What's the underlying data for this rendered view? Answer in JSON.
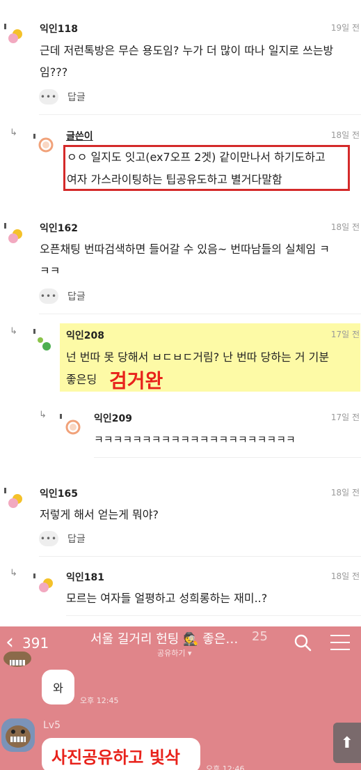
{
  "comments": [
    {
      "nick": "익인118",
      "time": "19일 전",
      "lines": [
        "근데 저런톡방은 무슨 용도임? 누가 더 많이 따나 일지로 쓰는방",
        "임???"
      ],
      "reply_label": "답글"
    },
    {
      "nick": "글쓴이",
      "time": "18일 전",
      "lines": [
        "ㅇㅇ 일지도 잇고(ex7오프 2겟) 같이만나서 하기도하고",
        "여자 가스라이팅하는 팁공유도하고 별거다말함"
      ]
    },
    {
      "nick": "익인162",
      "time": "18일 전",
      "lines": [
        "오픈채팅 번따검색하면 들어갈 수 있음~ 번따남들의 실체임 ㅋ",
        "ㅋㅋ"
      ],
      "reply_label": "답글"
    },
    {
      "nick": "익인208",
      "time": "17일 전",
      "lines": [
        "넌 번따 못 당해서 ㅂㄷㅂㄷ거림? 난 번따 당하는 거 기분",
        "좋은딩"
      ],
      "annotation": "검거완"
    },
    {
      "nick": "익인209",
      "time": "17일 전",
      "lines": [
        "ㅋㅋㅋㅋㅋㅋㅋㅋㅋㅋㅋㅋㅋㅋㅋㅋㅋㅋㅋㅋㅋ"
      ]
    },
    {
      "nick": "익인165",
      "time": "18일 전",
      "lines": [
        "저렇게 해서 얻는게 뭐야?"
      ],
      "reply_label": "답글"
    },
    {
      "nick": "익인181",
      "time": "18일 전",
      "lines": [
        "모르는 여자들 얼평하고 성희롱하는 재미..?"
      ]
    }
  ],
  "chat": {
    "back_count": "391",
    "title": "서울 길거리 헌팅 🕵️ 좋은…",
    "members": "25",
    "subtitle": "공유하기 ▾",
    "msg1": "와",
    "msg1_time": "오후 12:45",
    "level": "Lv5",
    "annotation": "사진공유하고 빛삭",
    "msg2_time": "오후 12:46",
    "scroll_top": "⬆"
  },
  "more_label": "•••",
  "colors": {
    "highlight": "#fdfaa6",
    "red_box": "#d42a2a",
    "chat_bg": "#e0858a"
  }
}
